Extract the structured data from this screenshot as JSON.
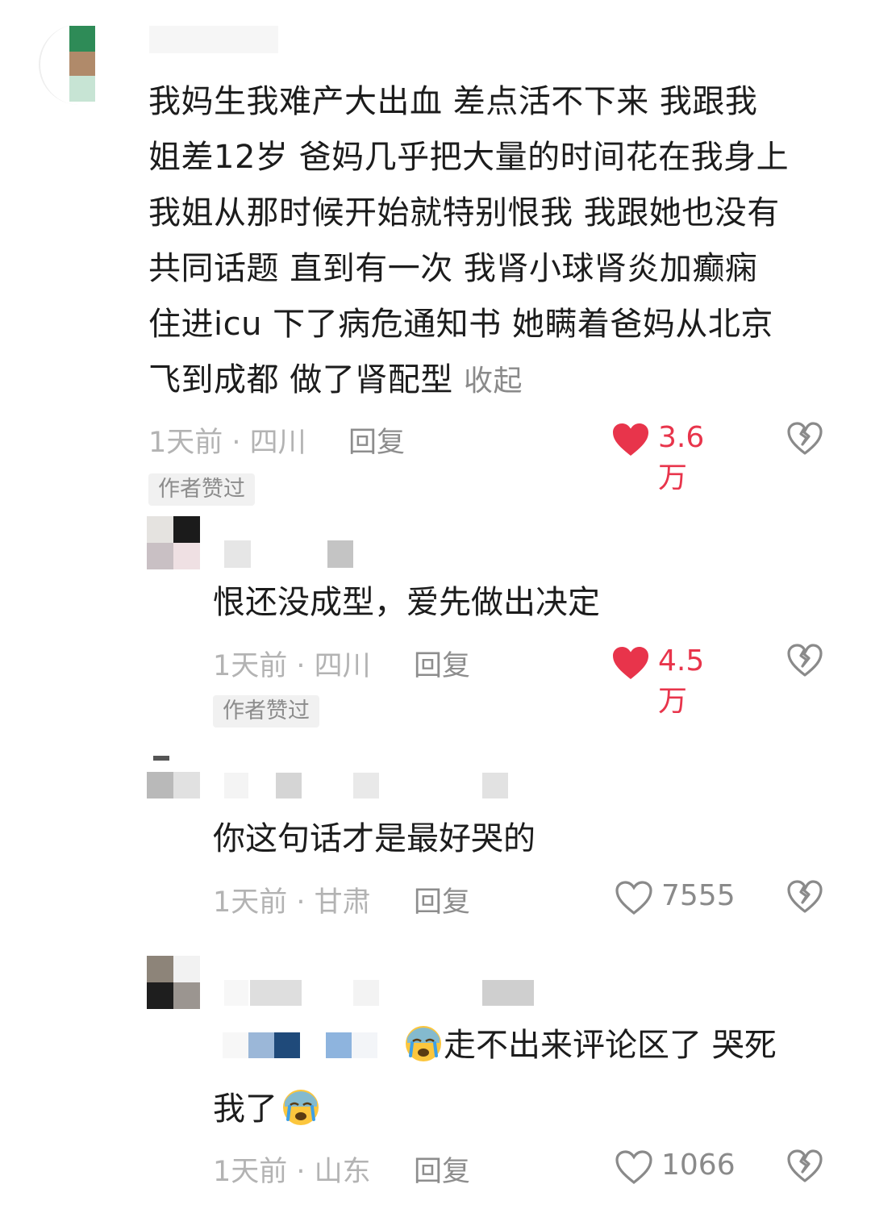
{
  "comments": [
    {
      "text_lines": [
        "我妈生我难产大出血 差点活不下来 我跟我",
        "姐差12岁 爸妈几乎把大量的时间花在我身上",
        "我姐从那时候开始就特别恨我 我跟她也没有",
        "共同话题 直到有一次 我肾小球肾炎加癫痫",
        "住进icu 下了病危通知书 她瞒着爸妈从北京",
        "飞到成都 做了肾配型"
      ],
      "collapse_label": "收起",
      "time": "1天前 · 四川",
      "reply_label": "回复",
      "likes": "3.6万",
      "liked": true,
      "badge": "作者赞过",
      "like_color": "#e8344b"
    },
    {
      "text": "恨还没成型，爱先做出决定",
      "time": "1天前 · 四川",
      "reply_label": "回复",
      "likes": "4.5万",
      "liked": true,
      "badge": "作者赞过"
    },
    {
      "text": "你这句话才是最好哭的",
      "time": "1天前 · 甘肃",
      "reply_label": "回复",
      "likes": "7555",
      "liked": false
    },
    {
      "text_line1": "走不出来评论区了 哭死",
      "text_line2": "我了",
      "emoji": "crying-face-emoji",
      "time": "1天前 · 山东",
      "reply_label": "回复",
      "likes": "1066",
      "liked": false
    }
  ]
}
